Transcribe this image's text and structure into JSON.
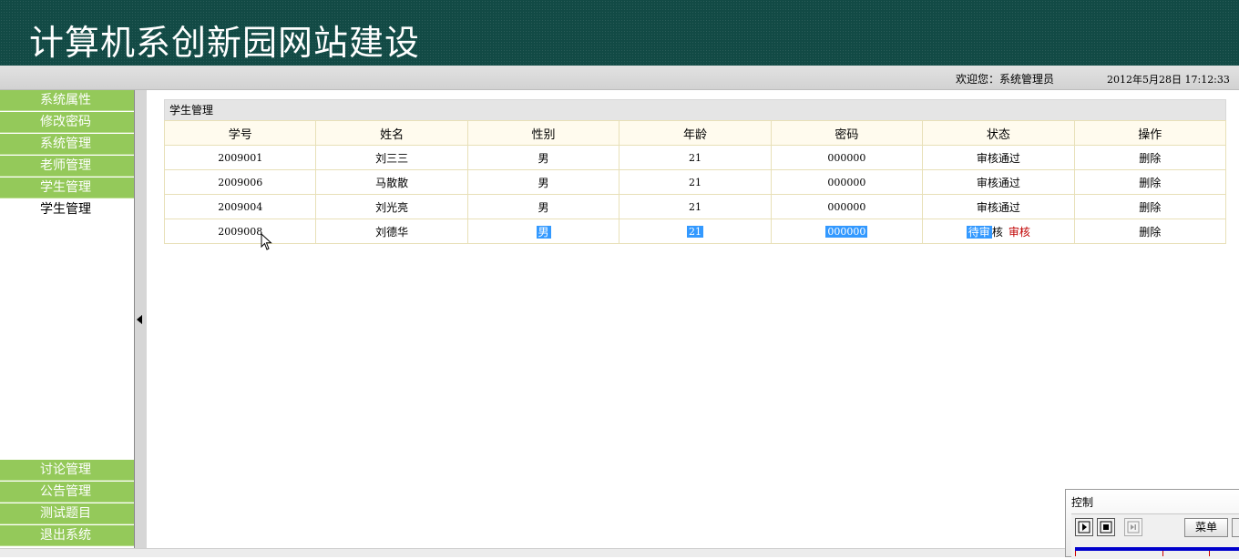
{
  "header": {
    "title": "计算机系创新园网站建设"
  },
  "topbar": {
    "welcome": "欢迎您：系统管理员",
    "datetime": "2012年5月28日  17:12:33"
  },
  "sidebar": {
    "top_items": [
      {
        "label": "系统属性"
      },
      {
        "label": "修改密码"
      },
      {
        "label": "系统管理"
      },
      {
        "label": "老师管理"
      },
      {
        "label": "学生管理"
      }
    ],
    "sub_item": {
      "label": "学生管理"
    },
    "bottom_items": [
      {
        "label": "讨论管理"
      },
      {
        "label": "公告管理"
      },
      {
        "label": "测试题目"
      },
      {
        "label": "退出系统"
      }
    ]
  },
  "panel": {
    "title": "学生管理",
    "columns": [
      "学号",
      "姓名",
      "性别",
      "年龄",
      "密码",
      "状态",
      "操作"
    ],
    "rows": [
      {
        "id": "2009001",
        "name": "刘三三",
        "gender": "男",
        "age": "21",
        "password": "000000",
        "status": "审核通过",
        "action": "删除"
      },
      {
        "id": "2009006",
        "name": "马散散",
        "gender": "男",
        "age": "21",
        "password": "000000",
        "status": "审核通过",
        "action": "删除"
      },
      {
        "id": "2009004",
        "name": "刘光亮",
        "gender": "男",
        "age": "21",
        "password": "000000",
        "status": "审核通过",
        "action": "删除"
      },
      {
        "id": "2009008",
        "name": "刘德华",
        "gender": "男",
        "age": "21",
        "password": "000000",
        "status_selected": "待审",
        "status_rest": "核",
        "review_link": "审核",
        "action": "删除"
      }
    ]
  },
  "control": {
    "title": "控制",
    "menu_label": "菜单"
  },
  "colors": {
    "header_bg": "#124a45",
    "menu_green": "#94c95a",
    "selection": "#3399ff",
    "review_red": "#c00000"
  },
  "icons": {
    "play": "play-icon",
    "stop": "stop-icon",
    "next": "next-frame-icon",
    "collapse": "triangle-left-icon",
    "cursor": "mouse-pointer-icon"
  }
}
